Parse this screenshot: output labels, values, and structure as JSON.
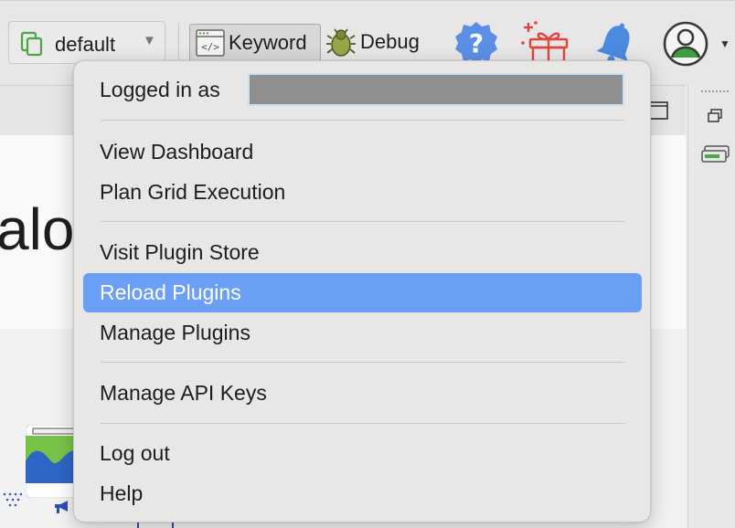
{
  "toolbar": {
    "profile": {
      "value": "default",
      "icon": "copy-icon"
    },
    "keyword_button": {
      "label": "Keyword",
      "icon": "code-window-icon"
    },
    "debug_button": {
      "label": "Debug",
      "icon": "bug-icon"
    },
    "icons": [
      "help-icon",
      "gift-icon",
      "bell-icon",
      "user-avatar-icon"
    ]
  },
  "background": {
    "heading_fragment": "alo"
  },
  "menu": {
    "header_label": "Logged in as",
    "items": [
      {
        "label": "View Dashboard",
        "active": false
      },
      {
        "label": "Plan Grid Execution",
        "active": false
      },
      {
        "label": "Visit Plugin Store",
        "active": false
      },
      {
        "label": "Reload Plugins",
        "active": true
      },
      {
        "label": "Manage Plugins",
        "active": false
      },
      {
        "label": "Manage API Keys",
        "active": false
      },
      {
        "label": "Log out",
        "active": false
      },
      {
        "label": "Help",
        "active": false
      }
    ]
  },
  "colors": {
    "menu_highlight": "#6a9ff5",
    "help_badge": "#5b8fe6",
    "gift": "#e0453c",
    "bell": "#4a8be0",
    "avatar": "#3f9e3f"
  }
}
